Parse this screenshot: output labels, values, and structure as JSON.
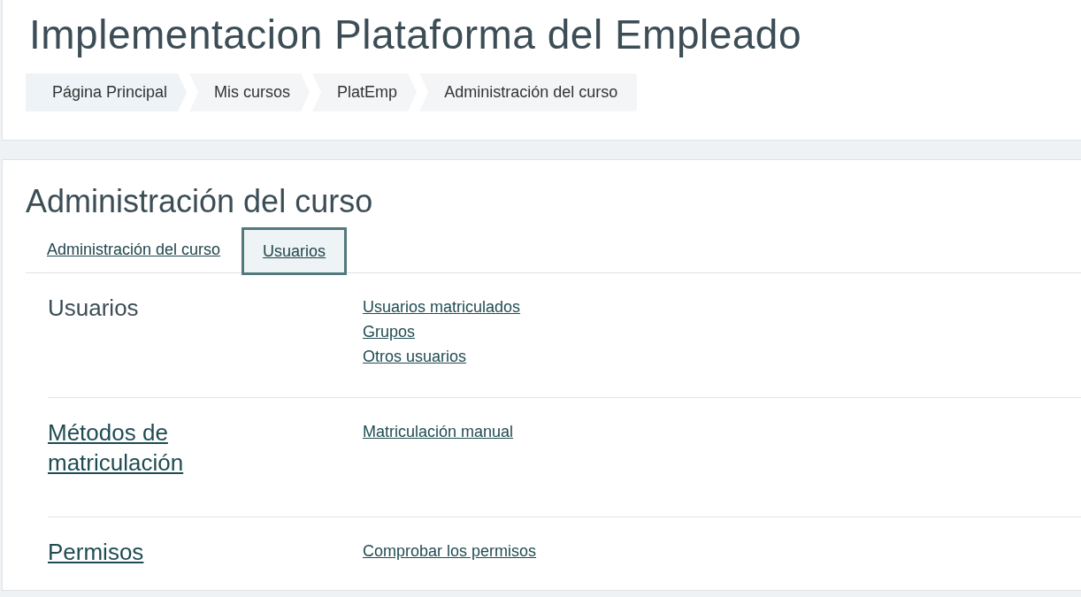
{
  "page_title": "Implementacion Plataforma del Empleado",
  "breadcrumb": [
    {
      "label": "Página Principal",
      "link": true
    },
    {
      "label": "Mis cursos",
      "link": true
    },
    {
      "label": "PlatEmp",
      "link": true
    },
    {
      "label": "Administración del curso",
      "link": false
    }
  ],
  "heading": "Administración del curso",
  "tabs": [
    {
      "label": "Administración del curso",
      "selected": false
    },
    {
      "label": "Usuarios",
      "selected": true
    }
  ],
  "sections": [
    {
      "title": "Usuarios",
      "linked": false,
      "links": [
        "Usuarios matriculados",
        "Grupos",
        "Otros usuarios"
      ]
    },
    {
      "title": "Métodos de matriculación",
      "linked": true,
      "links": [
        "Matriculación manual"
      ]
    },
    {
      "title": "Permisos",
      "linked": true,
      "links": [
        "Comprobar los permisos"
      ]
    }
  ]
}
